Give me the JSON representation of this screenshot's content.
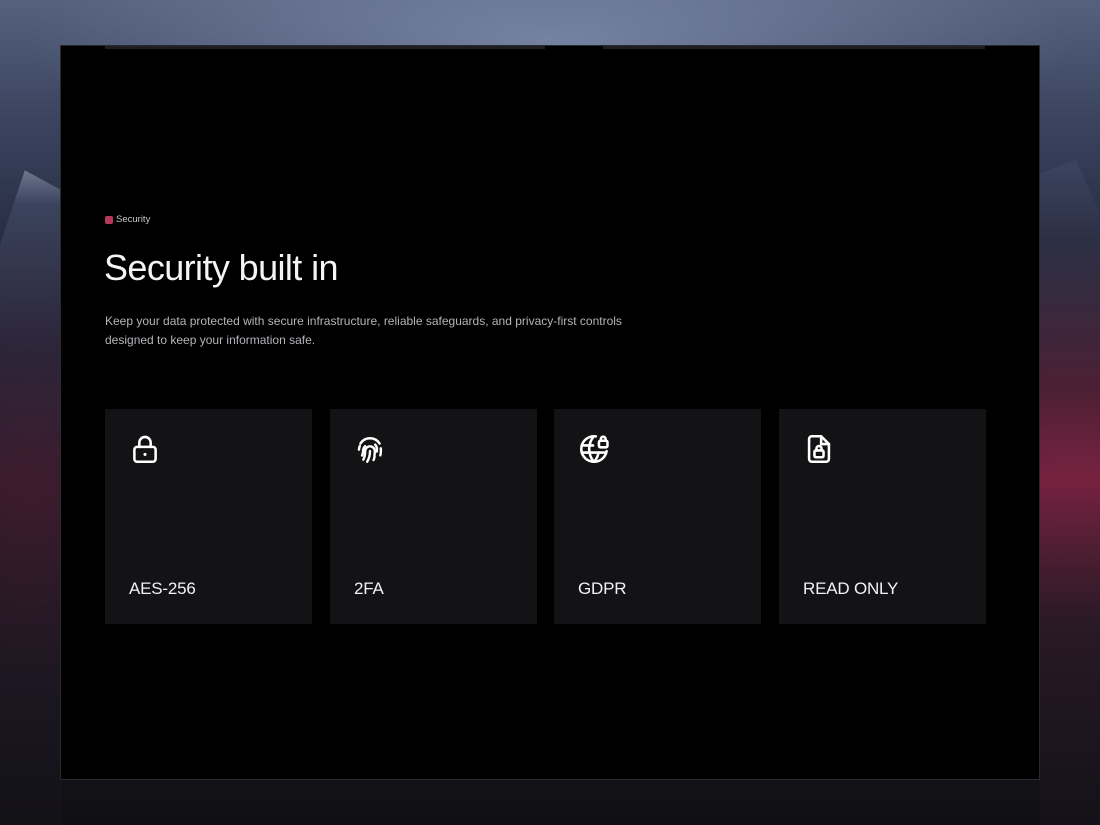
{
  "theme": {
    "accent": "#b8365c",
    "card_bg": "#131315",
    "page_bg": "#000000"
  },
  "section": {
    "eyebrow": "Security",
    "title": "Security built in",
    "description": "Keep your data protected with secure infrastructure, reliable safeguards, and privacy-first controls designed to keep your information safe."
  },
  "features": [
    {
      "icon": "lock-icon",
      "label": "AES-256"
    },
    {
      "icon": "fingerprint-icon",
      "label": "2FA"
    },
    {
      "icon": "globe-lock-icon",
      "label": "GDPR"
    },
    {
      "icon": "file-lock-icon",
      "label": "READ ONLY"
    }
  ]
}
